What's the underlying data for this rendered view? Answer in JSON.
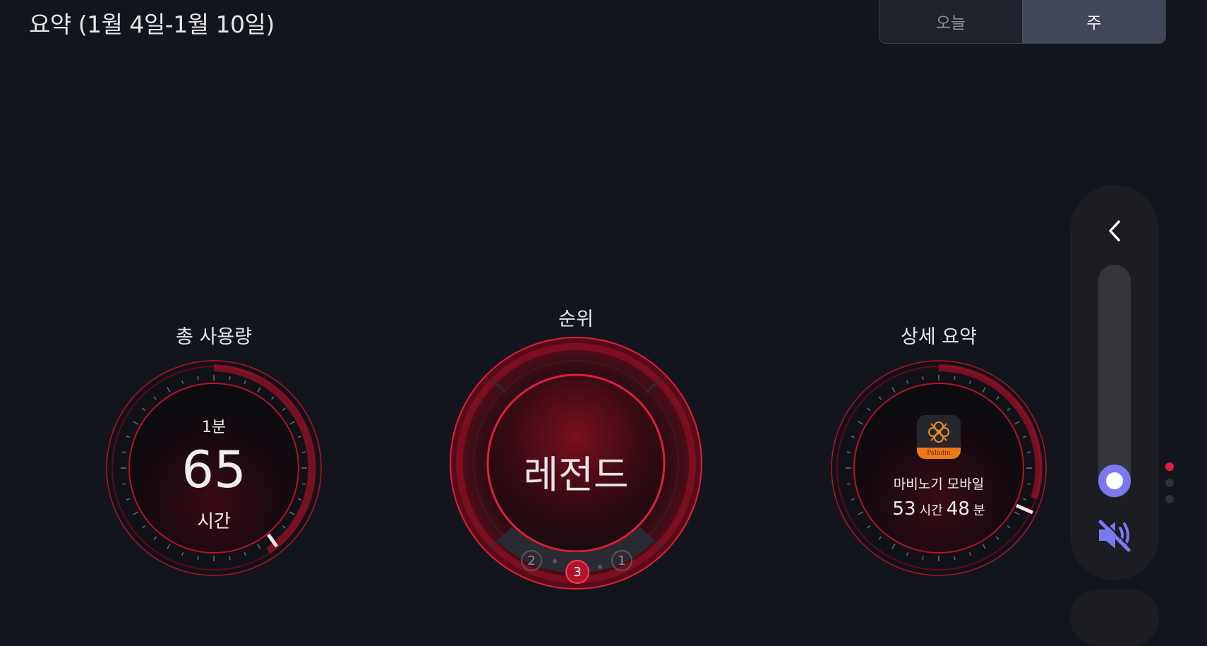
{
  "header": {
    "title": "요약 (1월 4일-1월 10일)"
  },
  "period_tabs": [
    {
      "label": "오늘",
      "selected": false
    },
    {
      "label": "주",
      "selected": true
    }
  ],
  "total_usage": {
    "title": "총 사용량",
    "sub_label": "1분",
    "value": "65",
    "unit": "시간"
  },
  "rank": {
    "title": "순위",
    "value": "레전드",
    "steps": [
      "2",
      "3",
      "1"
    ],
    "current_step": "3"
  },
  "detail": {
    "title": "상세 요약",
    "app_name": "마비노기 모바일",
    "app_icon_text": "Paladin",
    "hours": "53",
    "hours_unit": "시간",
    "minutes": "48",
    "minutes_unit": "분"
  },
  "side_panel": {
    "collapse_icon": "chevron-left-icon",
    "mute_icon": "speaker-muted-icon",
    "volume_level": 0.05
  },
  "page_indicator": {
    "count": 3,
    "active": 0
  },
  "colors": {
    "accent": "#e01e3c",
    "slider": "#7b78f0",
    "background": "#13151c"
  }
}
